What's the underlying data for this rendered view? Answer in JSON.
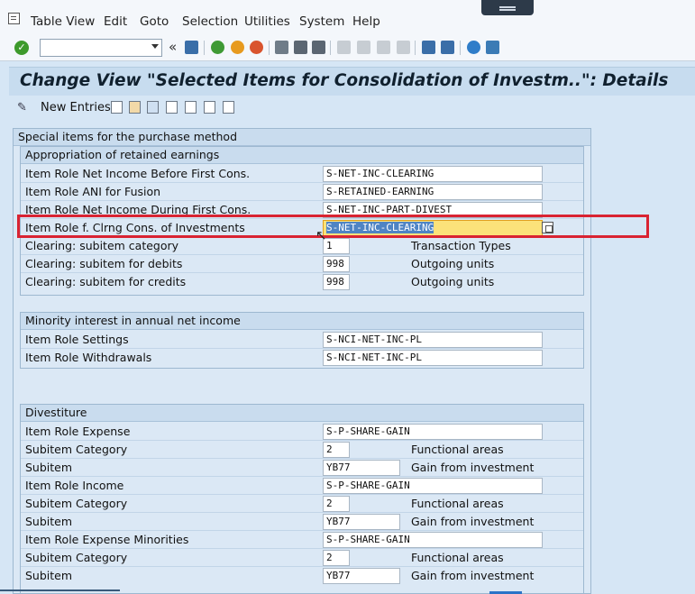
{
  "menu": {
    "items": [
      {
        "label": "Table View"
      },
      {
        "label": "Edit"
      },
      {
        "label": "Goto"
      },
      {
        "label": "Selection"
      },
      {
        "label": "Utilities"
      },
      {
        "label": "System"
      },
      {
        "label": "Help"
      }
    ]
  },
  "toolbar": {
    "command_value": "",
    "back_symbol": "«"
  },
  "title": "Change View \"Selected Items for Consolidation of Investm..\": Details",
  "app_toolbar": {
    "new_entries": "New Entries"
  },
  "special": {
    "title": "Special items for the purchase method",
    "retained": {
      "title": "Appropriation of retained earnings",
      "rows": [
        {
          "label": "Item Role Net Income Before First Cons.",
          "value": "S-NET-INC-CLEARING",
          "desc": ""
        },
        {
          "label": "Item Role ANI for Fusion",
          "value": "S-RETAINED-EARNING",
          "desc": ""
        },
        {
          "label": "Item Role Net Income During First Cons.",
          "value": "S-NET-INC-PART-DIVEST",
          "desc": ""
        },
        {
          "label": "Item Role f. Clrng Cons. of Investments",
          "value": "S-NET-INC-CLEARING",
          "desc": ""
        },
        {
          "label": "Clearing: subitem category",
          "value": "1",
          "desc": "Transaction Types"
        },
        {
          "label": "Clearing: subitem for debits",
          "value": "998",
          "desc": "Outgoing units"
        },
        {
          "label": "Clearing: subitem for credits",
          "value": "998",
          "desc": "Outgoing units"
        }
      ]
    },
    "minority": {
      "title": "Minority interest in annual net income",
      "rows": [
        {
          "label": "Item Role Settings",
          "value": "S-NCI-NET-INC-PL"
        },
        {
          "label": "Item Role Withdrawals",
          "value": "S-NCI-NET-INC-PL"
        }
      ]
    },
    "divestiture": {
      "title": "Divestiture",
      "rows": [
        {
          "label": "Item Role Expense",
          "value": "S-P-SHARE-GAIN",
          "desc": ""
        },
        {
          "label": "Subitem Category",
          "value": "2",
          "desc": "Functional areas"
        },
        {
          "label": "Subitem",
          "value": "YB77",
          "desc": "Gain from investment"
        },
        {
          "label": "Item Role Income",
          "value": "S-P-SHARE-GAIN",
          "desc": ""
        },
        {
          "label": "Subitem Category",
          "value": "2",
          "desc": "Functional areas"
        },
        {
          "label": "Subitem",
          "value": "YB77",
          "desc": "Gain from investment"
        },
        {
          "label": "Item Role Expense Minorities",
          "value": "S-P-SHARE-GAIN",
          "desc": ""
        },
        {
          "label": "Subitem Category",
          "value": "2",
          "desc": "Functional areas"
        },
        {
          "label": "Subitem",
          "value": "YB77",
          "desc": "Gain from investment"
        }
      ]
    }
  },
  "colors": {
    "highlight_border": "#d92332",
    "focused_field": "#fbe27a",
    "selection": "#4f84c4"
  }
}
